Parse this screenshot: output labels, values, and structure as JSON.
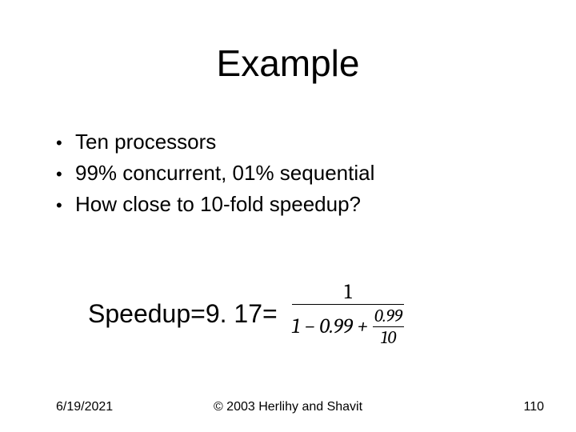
{
  "title": "Example",
  "bullets": [
    "Ten processors",
    "99% concurrent, 01% sequential",
    "How close to 10-fold speedup?"
  ],
  "result_prefix": "Speedup=9. 17=",
  "formula": {
    "numerator": "1",
    "den_left": "1 − 0.99 +",
    "inner_num": "0.99",
    "inner_den": "10"
  },
  "footer": {
    "date": "6/19/2021",
    "copyright": "© 2003 Herlihy and Shavit",
    "page": "110"
  },
  "chart_data": {
    "type": "table",
    "title": "Amdahl's Law speedup example",
    "parameters": {
      "processors": 10,
      "parallel_fraction": 0.99,
      "sequential_fraction": 0.01
    },
    "computed_speedup": 9.17,
    "formula_text": "1 / (1 - 0.99 + 0.99/10)"
  }
}
